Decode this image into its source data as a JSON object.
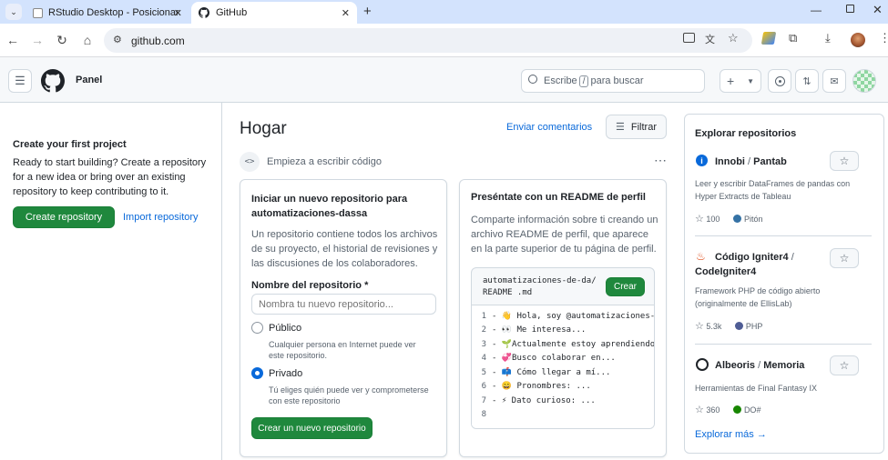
{
  "browser": {
    "tabs": [
      {
        "title": "RStudio Desktop - Posicionar"
      },
      {
        "title": "GitHub"
      }
    ],
    "url": "github.com"
  },
  "header": {
    "title": "Panel",
    "search_prefix": "Escribe",
    "search_key": "/",
    "search_suffix": "para buscar",
    "plus_label": "+"
  },
  "left": {
    "heading": "Create your first project",
    "body": "Ready to start building? Create a repository for a new idea or bring over an existing repository to keep contributing to it.",
    "create_button": "Create repository",
    "import_link": "Import repository"
  },
  "main": {
    "title": "Hogar",
    "feedback_link": "Enviar comentarios",
    "filter_button": "Filtrar",
    "code_prompt": "Empieza a escribir código",
    "new_repo_card": {
      "title": "Iniciar un nuevo repositorio para automatizaciones-dassa",
      "description": "Un repositorio contiene todos los archivos de su proyecto, el historial de revisiones y las discusiones de los colaboradores.",
      "name_label": "Nombre del repositorio *",
      "name_placeholder": "Nombra tu nuevo repositorio...",
      "public_label": "Público",
      "public_desc": "Cualquier persona en Internet puede ver este repositorio.",
      "private_label": "Privado",
      "private_desc": "Tú eliges quién puede ver y comprometerse con este repositorio",
      "submit_button": "Crear un nuevo repositorio"
    },
    "readme_card": {
      "title": "Preséntate con un README de perfil",
      "description": "Comparte información sobre ti creando un archivo README de perfil, que aparece en la parte superior de tu página de perfil.",
      "file_path": "automatizaciones-de-da/ README .md",
      "create_button": "Crear",
      "lines": [
        {
          "n": "1",
          "text": "- 👋 Hola, soy @automatizaciones-d"
        },
        {
          "n": "2",
          "text": "- 👀 Me interesa..."
        },
        {
          "n": "3",
          "text": "- 🌱Actualmente estoy aprendiendo."
        },
        {
          "n": "4",
          "text": "- 💞️Busco colaborar en..."
        },
        {
          "n": "5",
          "text": "- 📫 Cómo llegar a mí..."
        },
        {
          "n": "6",
          "text": "- 😄 Pronombres: ..."
        },
        {
          "n": "7",
          "text": "- ⚡ Dato curioso: ..."
        },
        {
          "n": "8",
          "text": ""
        }
      ]
    }
  },
  "explore": {
    "title": "Explorar repositorios",
    "repos": [
      {
        "owner": "Innobi",
        "name": "Pantab",
        "desc": "Leer y escribir DataFrames de pandas con Hyper Extracts de Tableau",
        "stars": "100",
        "language": "Pitón",
        "lang_color": "#3572A5"
      },
      {
        "owner": "Código Igniter4",
        "name": "CodeIgniter4",
        "desc": "Framework PHP de código abierto (originalmente de EllisLab)",
        "stars": "5.3k",
        "language": "PHP",
        "lang_color": "#4F5D95"
      },
      {
        "owner": "Albeoris",
        "name": "Memoria",
        "desc": "Herramientas de Final Fantasy IX",
        "stars": "360",
        "language": "DO#",
        "lang_color": "#178600"
      }
    ],
    "more_link": "Explorar más →"
  },
  "colors": {
    "accent": "#0969da",
    "primary_button": "#1f883d",
    "chrome_tabbar": "#d3e3fd"
  }
}
